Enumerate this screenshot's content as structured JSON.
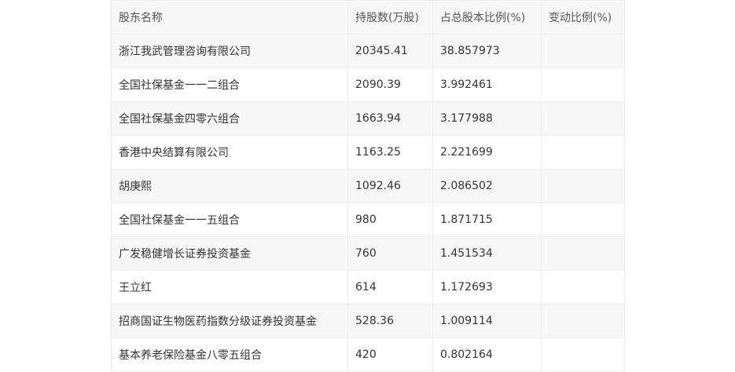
{
  "table": {
    "headers": [
      "股东名称",
      "持股数(万股)",
      "占总股本比例(%)",
      "变动比例(%)"
    ],
    "rows": [
      {
        "name": "浙江我武管理咨询有限公司",
        "shares": "20345.41",
        "pct": "38.857973",
        "change": ""
      },
      {
        "name": "全国社保基金一一二组合",
        "shares": "2090.39",
        "pct": "3.992461",
        "change": ""
      },
      {
        "name": "全国社保基金四零六组合",
        "shares": "1663.94",
        "pct": "3.177988",
        "change": ""
      },
      {
        "name": "香港中央结算有限公司",
        "shares": "1163.25",
        "pct": "2.221699",
        "change": ""
      },
      {
        "name": "胡庚熙",
        "shares": "1092.46",
        "pct": "2.086502",
        "change": ""
      },
      {
        "name": "全国社保基金一一五组合",
        "shares": "980",
        "pct": "1.871715",
        "change": ""
      },
      {
        "name": "广发稳健增长证券投资基金",
        "shares": "760",
        "pct": "1.451534",
        "change": ""
      },
      {
        "name": "王立红",
        "shares": "614",
        "pct": "1.172693",
        "change": ""
      },
      {
        "name": "招商国证生物医药指数分级证券投资基金",
        "shares": "528.36",
        "pct": "1.009114",
        "change": ""
      },
      {
        "name": "基本养老保险基金八零五组合",
        "shares": "420",
        "pct": "0.802164",
        "change": ""
      }
    ]
  }
}
